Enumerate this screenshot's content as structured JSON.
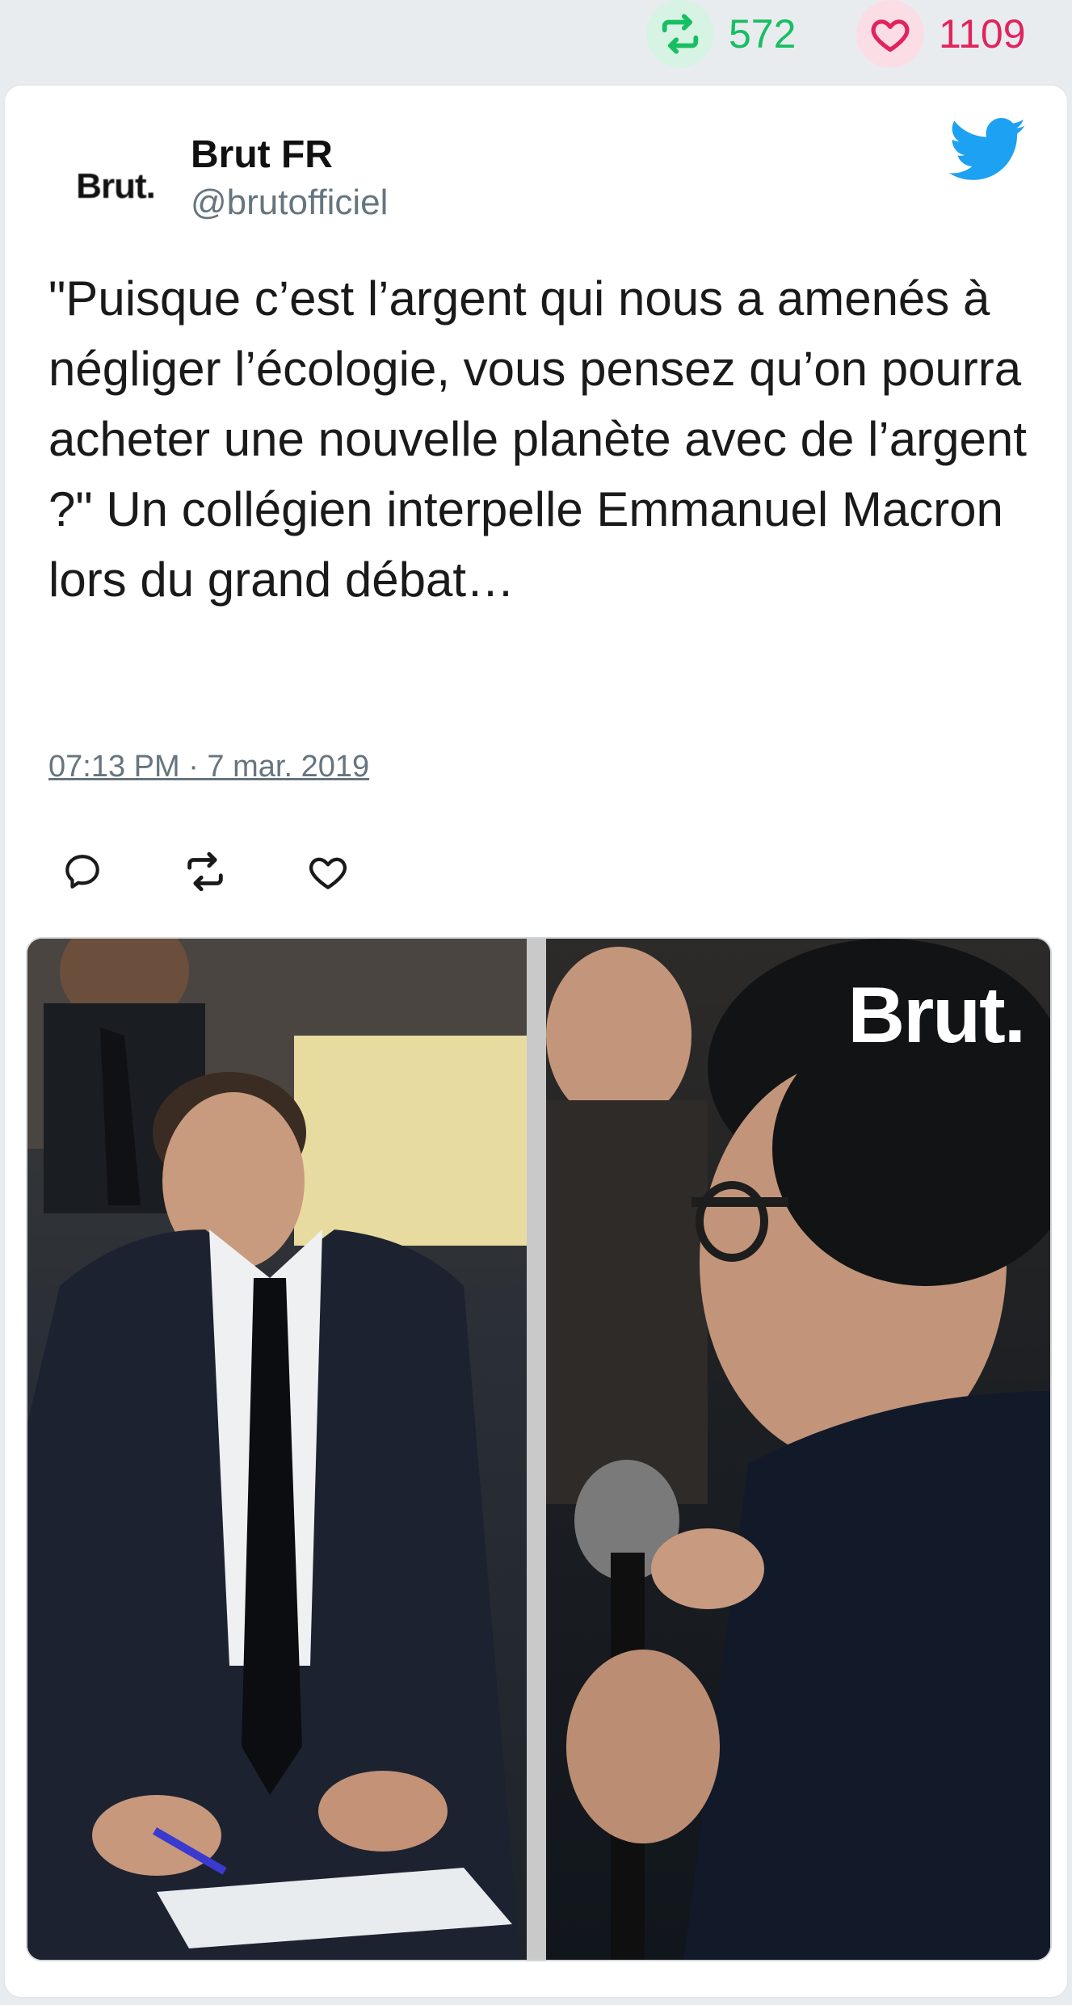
{
  "stats": {
    "retweet_count": "572",
    "like_count": "1109",
    "retweet_icon": "retweet-icon",
    "like_icon": "heart-icon"
  },
  "tweet": {
    "avatar_text": "Brut.",
    "author_name": "Brut FR",
    "author_handle": "@brutofficiel",
    "text": "\"Puisque c’est l’argent qui nous a amenés à négliger l’écologie, vous pensez qu’on pourra acheter une nouvelle planète avec de l’argent ?\" Un collégien interpelle Emmanuel Macron lors du grand débat…",
    "timestamp": "07:13 PM · 7 mar. 2019",
    "logo_icon": "twitter-bird-icon"
  },
  "media": {
    "watermark": "Brut."
  },
  "colors": {
    "retweet": "#17bf63",
    "like": "#e0245e",
    "twitter_blue": "#1da1f2",
    "muted": "#66757f"
  }
}
